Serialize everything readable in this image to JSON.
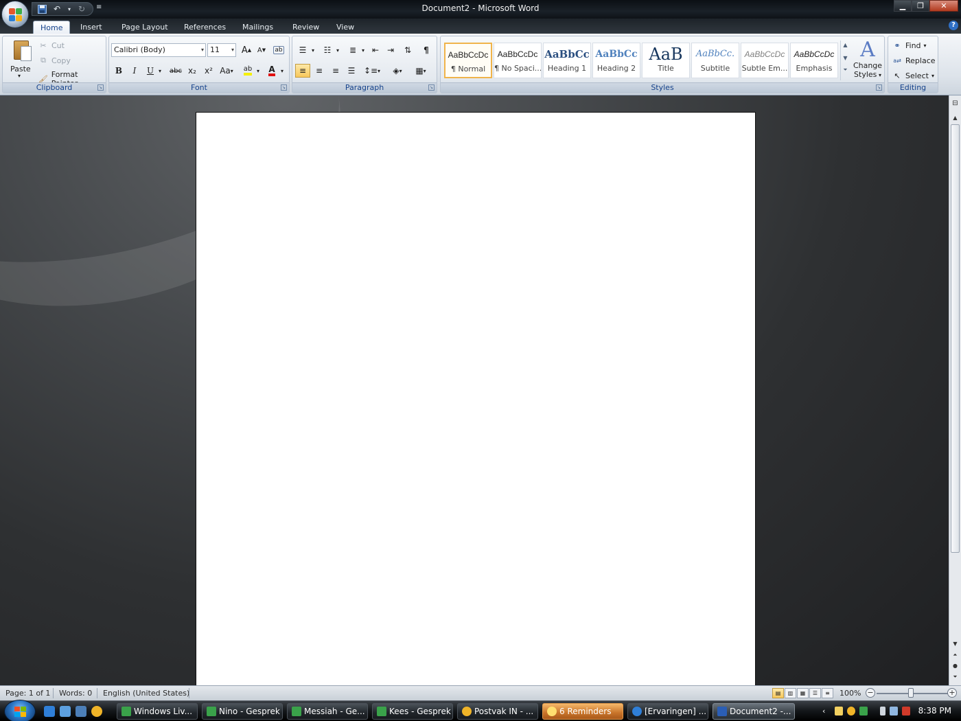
{
  "window": {
    "title": "Document2 - Microsoft Word"
  },
  "qat": {
    "more": "≡"
  },
  "tabs": [
    {
      "label": "Home"
    },
    {
      "label": "Insert"
    },
    {
      "label": "Page Layout"
    },
    {
      "label": "References"
    },
    {
      "label": "Mailings"
    },
    {
      "label": "Review"
    },
    {
      "label": "View"
    }
  ],
  "help": "?",
  "clipboard": {
    "group_label": "Clipboard",
    "paste": "Paste",
    "cut": "Cut",
    "copy": "Copy",
    "format_painter": "Format Painter"
  },
  "font": {
    "group_label": "Font",
    "family": "Calibri (Body)",
    "size": "11",
    "grow": "A",
    "shrink": "A",
    "bold": "B",
    "italic": "I",
    "underline": "U",
    "strike": "abc",
    "subscript": "x₂",
    "superscript": "x²",
    "change_case": "Aa",
    "highlight": "ab",
    "color": "A"
  },
  "paragraph": {
    "group_label": "Paragraph",
    "pilcrow": "¶"
  },
  "styles": {
    "group_label": "Styles",
    "items": [
      {
        "sample": "AaBbCcDc",
        "name": "¶ Normal"
      },
      {
        "sample": "AaBbCcDc",
        "name": "¶ No Spaci..."
      },
      {
        "sample": "AaBbCc",
        "name": "Heading 1"
      },
      {
        "sample": "AaBbCc",
        "name": "Heading 2"
      },
      {
        "sample": "AaB",
        "name": "Title"
      },
      {
        "sample": "AaBbCc.",
        "name": "Subtitle"
      },
      {
        "sample": "AaBbCcDc",
        "name": "Subtle Em..."
      },
      {
        "sample": "AaBbCcDc",
        "name": "Emphasis"
      }
    ],
    "change_styles_line1": "Change",
    "change_styles_line2": "Styles"
  },
  "editing": {
    "group_label": "Editing",
    "find": "Find",
    "replace": "Replace",
    "select": "Select"
  },
  "status": {
    "page": "Page: 1 of 1",
    "words": "Words: 0",
    "language": "English (United States)",
    "zoom": "100%"
  },
  "taskbar": {
    "items": [
      {
        "label": "Windows Liv..."
      },
      {
        "label": "Nino - Gesprek"
      },
      {
        "label": "Messiah - Ge..."
      },
      {
        "label": "Kees - Gesprek"
      },
      {
        "label": "Postvak IN - ..."
      },
      {
        "label": "6 Reminders"
      },
      {
        "label": "[Ervaringen] ..."
      },
      {
        "label": "Document2 -..."
      }
    ],
    "clock": "8:38 PM"
  }
}
